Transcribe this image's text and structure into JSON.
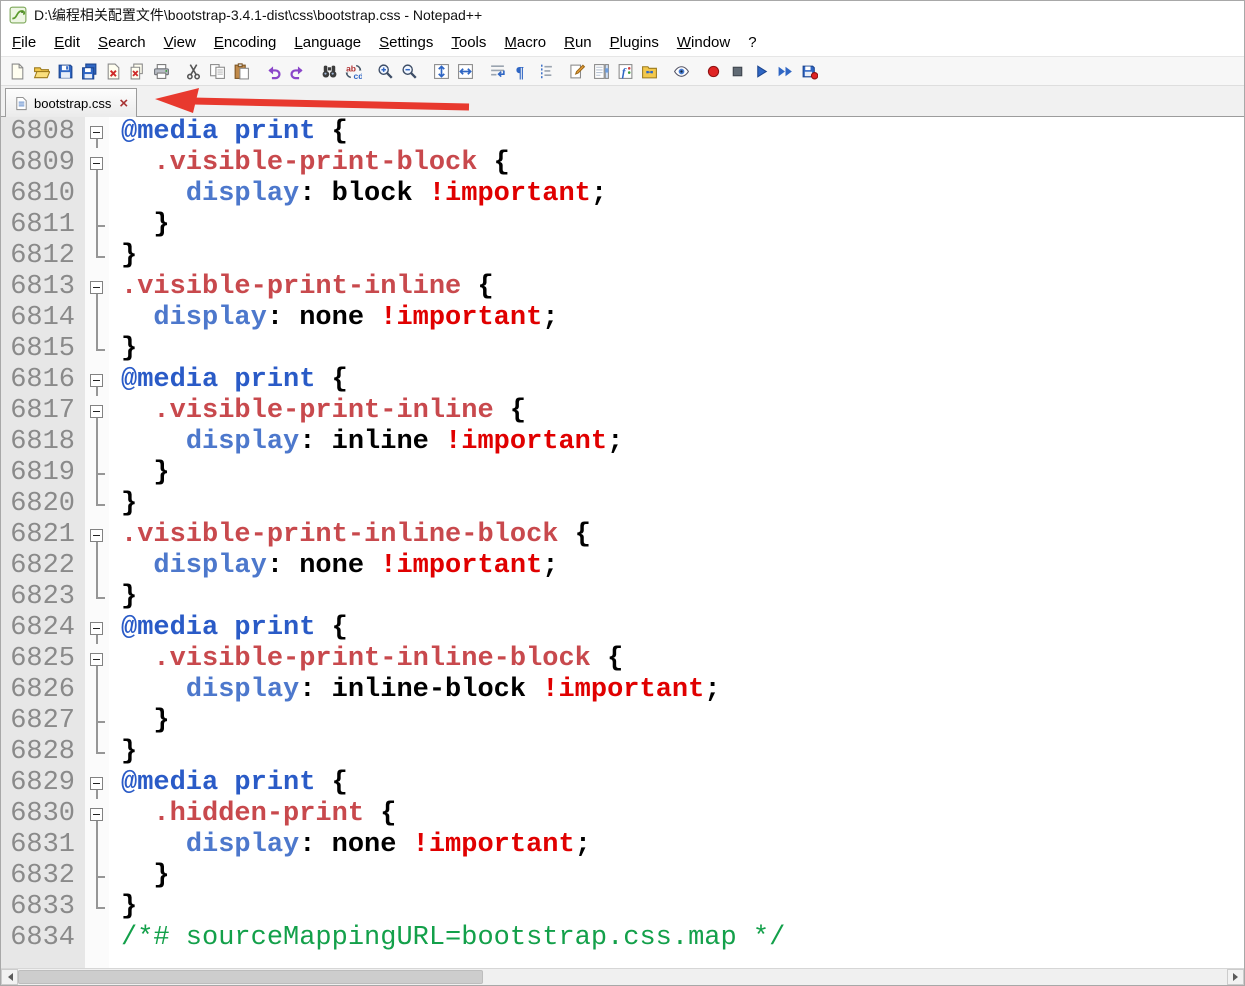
{
  "window": {
    "title": "D:\\编程相关配置文件\\bootstrap-3.4.1-dist\\css\\bootstrap.css - Notepad++"
  },
  "menu": {
    "items": [
      "File",
      "Edit",
      "Search",
      "View",
      "Encoding",
      "Language",
      "Settings",
      "Tools",
      "Macro",
      "Run",
      "Plugins",
      "Window",
      "?"
    ]
  },
  "toolbar": {
    "icons": [
      "new-file",
      "open-file",
      "save",
      "save-all",
      "close",
      "close-all",
      "print",
      "|",
      "cut",
      "copy",
      "paste",
      "|",
      "undo",
      "redo",
      "|",
      "find",
      "replace",
      "|",
      "zoom-in",
      "zoom-out",
      "|",
      "sync-vertical-scroll",
      "sync-horizontal-scroll",
      "|",
      "word-wrap",
      "show-all-characters",
      "show-indent-guide",
      "|",
      "define-language",
      "document-map",
      "function-list",
      "folder-as-workspace",
      "|",
      "monitoring",
      "|",
      "macro-record",
      "macro-stop",
      "macro-play",
      "macro-run-multiple",
      "macro-save"
    ]
  },
  "tab_bar": {
    "tabs": [
      {
        "label": "bootstrap.css",
        "active": true,
        "close_icon": "×"
      }
    ]
  },
  "annotation": {
    "shape": "red-arrow-pointing-left-at-tab",
    "color": "#e8392e"
  },
  "colors": {
    "at": "#2a5bc7",
    "sel": "#c8494d",
    "prop": "#4d78cc",
    "val": "#000000",
    "imp": "#e00000",
    "br": "#000000",
    "com": "#13a04a",
    "line_number": "#8a8a8a",
    "gutter_bg": "#e7e7e7"
  },
  "editor": {
    "language": "css",
    "lines": [
      {
        "n": 6808,
        "f": "s",
        "s": [
          [
            "@media print",
            "at"
          ],
          [
            " ",
            "pl"
          ],
          [
            "{",
            "br"
          ]
        ]
      },
      {
        "n": 6809,
        "f": "s",
        "s": [
          [
            "  ",
            "pl"
          ],
          [
            ".visible-print-block",
            "sel"
          ],
          [
            " ",
            "pl"
          ],
          [
            "{",
            "br"
          ]
        ]
      },
      {
        "n": 6810,
        "f": "m",
        "s": [
          [
            "    ",
            "pl"
          ],
          [
            "display",
            "prop"
          ],
          [
            ": ",
            "pl"
          ],
          [
            "block",
            "val"
          ],
          [
            " ",
            "pl"
          ],
          [
            "!important",
            "imp"
          ],
          [
            ";",
            "pl"
          ]
        ]
      },
      {
        "n": 6811,
        "f": "t",
        "s": [
          [
            "  ",
            "pl"
          ],
          [
            "}",
            "br"
          ]
        ]
      },
      {
        "n": 6812,
        "f": "e",
        "s": [
          [
            "}",
            "br"
          ]
        ]
      },
      {
        "n": 6813,
        "f": "s",
        "s": [
          [
            ".visible-print-inline",
            "sel"
          ],
          [
            " ",
            "pl"
          ],
          [
            "{",
            "br"
          ]
        ]
      },
      {
        "n": 6814,
        "f": "m",
        "s": [
          [
            "  ",
            "pl"
          ],
          [
            "display",
            "prop"
          ],
          [
            ": ",
            "pl"
          ],
          [
            "none",
            "val"
          ],
          [
            " ",
            "pl"
          ],
          [
            "!important",
            "imp"
          ],
          [
            ";",
            "pl"
          ]
        ]
      },
      {
        "n": 6815,
        "f": "e",
        "s": [
          [
            "}",
            "br"
          ]
        ]
      },
      {
        "n": 6816,
        "f": "s",
        "s": [
          [
            "@media print",
            "at"
          ],
          [
            " ",
            "pl"
          ],
          [
            "{",
            "br"
          ]
        ]
      },
      {
        "n": 6817,
        "f": "s",
        "s": [
          [
            "  ",
            "pl"
          ],
          [
            ".visible-print-inline",
            "sel"
          ],
          [
            " ",
            "pl"
          ],
          [
            "{",
            "br"
          ]
        ]
      },
      {
        "n": 6818,
        "f": "m",
        "s": [
          [
            "    ",
            "pl"
          ],
          [
            "display",
            "prop"
          ],
          [
            ": ",
            "pl"
          ],
          [
            "inline",
            "val"
          ],
          [
            " ",
            "pl"
          ],
          [
            "!important",
            "imp"
          ],
          [
            ";",
            "pl"
          ]
        ]
      },
      {
        "n": 6819,
        "f": "t",
        "s": [
          [
            "  ",
            "pl"
          ],
          [
            "}",
            "br"
          ]
        ]
      },
      {
        "n": 6820,
        "f": "e",
        "s": [
          [
            "}",
            "br"
          ]
        ]
      },
      {
        "n": 6821,
        "f": "s",
        "s": [
          [
            ".visible-print-inline-block",
            "sel"
          ],
          [
            " ",
            "pl"
          ],
          [
            "{",
            "br"
          ]
        ]
      },
      {
        "n": 6822,
        "f": "m",
        "s": [
          [
            "  ",
            "pl"
          ],
          [
            "display",
            "prop"
          ],
          [
            ": ",
            "pl"
          ],
          [
            "none",
            "val"
          ],
          [
            " ",
            "pl"
          ],
          [
            "!important",
            "imp"
          ],
          [
            ";",
            "pl"
          ]
        ]
      },
      {
        "n": 6823,
        "f": "e",
        "s": [
          [
            "}",
            "br"
          ]
        ]
      },
      {
        "n": 6824,
        "f": "s",
        "s": [
          [
            "@media print",
            "at"
          ],
          [
            " ",
            "pl"
          ],
          [
            "{",
            "br"
          ]
        ]
      },
      {
        "n": 6825,
        "f": "s",
        "s": [
          [
            "  ",
            "pl"
          ],
          [
            ".visible-print-inline-block",
            "sel"
          ],
          [
            " ",
            "pl"
          ],
          [
            "{",
            "br"
          ]
        ]
      },
      {
        "n": 6826,
        "f": "m",
        "s": [
          [
            "    ",
            "pl"
          ],
          [
            "display",
            "prop"
          ],
          [
            ": ",
            "pl"
          ],
          [
            "inline-block",
            "val"
          ],
          [
            " ",
            "pl"
          ],
          [
            "!important",
            "imp"
          ],
          [
            ";",
            "pl"
          ]
        ]
      },
      {
        "n": 6827,
        "f": "t",
        "s": [
          [
            "  ",
            "pl"
          ],
          [
            "}",
            "br"
          ]
        ]
      },
      {
        "n": 6828,
        "f": "e",
        "s": [
          [
            "}",
            "br"
          ]
        ]
      },
      {
        "n": 6829,
        "f": "s",
        "s": [
          [
            "@media print",
            "at"
          ],
          [
            " ",
            "pl"
          ],
          [
            "{",
            "br"
          ]
        ]
      },
      {
        "n": 6830,
        "f": "s",
        "s": [
          [
            "  ",
            "pl"
          ],
          [
            ".hidden-print",
            "sel"
          ],
          [
            " ",
            "pl"
          ],
          [
            "{",
            "br"
          ]
        ]
      },
      {
        "n": 6831,
        "f": "m",
        "s": [
          [
            "    ",
            "pl"
          ],
          [
            "display",
            "prop"
          ],
          [
            ": ",
            "pl"
          ],
          [
            "none",
            "val"
          ],
          [
            " ",
            "pl"
          ],
          [
            "!important",
            "imp"
          ],
          [
            ";",
            "pl"
          ]
        ]
      },
      {
        "n": 6832,
        "f": "t",
        "s": [
          [
            "  ",
            "pl"
          ],
          [
            "}",
            "br"
          ]
        ]
      },
      {
        "n": 6833,
        "f": "e",
        "s": [
          [
            "}",
            "br"
          ]
        ]
      },
      {
        "n": 6834,
        "f": "",
        "s": [
          [
            "/*# sourceMappingURL=bootstrap.css.map */",
            "com"
          ]
        ]
      }
    ]
  }
}
